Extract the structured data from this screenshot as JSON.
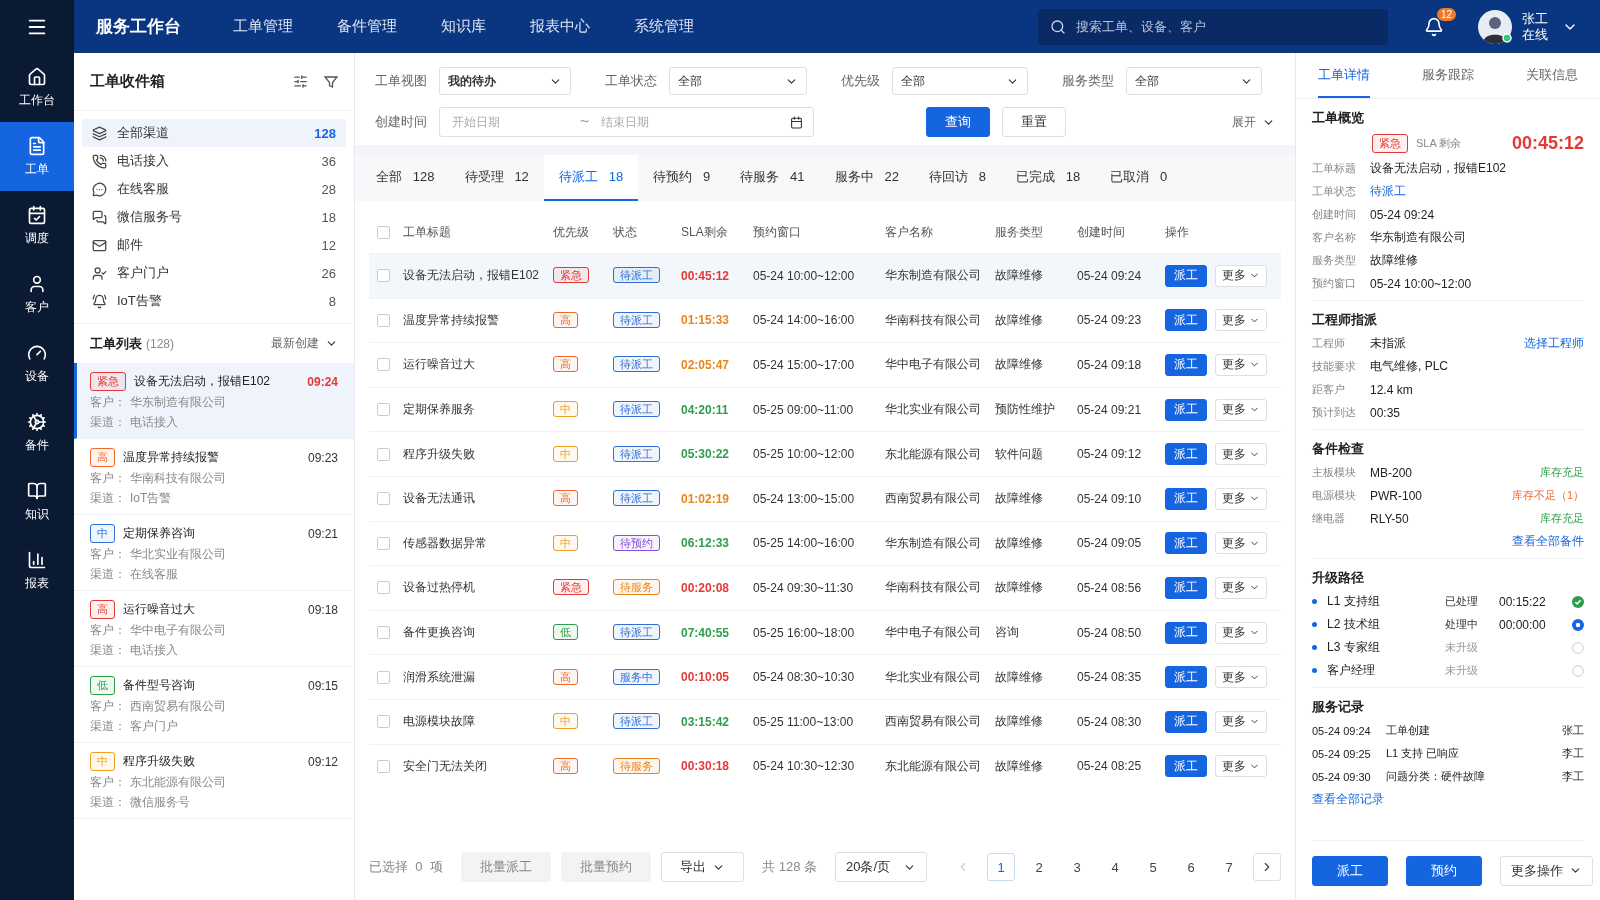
{
  "app": {
    "brand": "服务工作台",
    "nav": [
      {
        "label": "工单管理",
        "selected": false
      },
      {
        "label": "备件管理",
        "selected": false
      },
      {
        "label": "知识库",
        "selected": false
      },
      {
        "label": "报表中心",
        "selected": false
      },
      {
        "label": "系统管理",
        "selected": false
      }
    ],
    "search": {
      "placeholder": "搜索工单、设备、客户"
    },
    "notifications": "12",
    "user": {
      "name": "张工",
      "status": "在线"
    }
  },
  "rail": [
    {
      "label": "工作台",
      "selected": false
    },
    {
      "label": "工单",
      "selected": true
    },
    {
      "label": "调度",
      "selected": false
    },
    {
      "label": "客户",
      "selected": false
    },
    {
      "label": "设备",
      "selected": false
    },
    {
      "label": "备件",
      "selected": false
    },
    {
      "label": "知识",
      "selected": false
    },
    {
      "label": "报表",
      "selected": false
    }
  ],
  "inbox": {
    "title": "工单收件箱",
    "channels": [
      {
        "label": "全部渠道",
        "count": "128",
        "selected": true
      },
      {
        "label": "电话接入",
        "count": "36",
        "selected": false
      },
      {
        "label": "在线客服",
        "count": "28",
        "selected": false
      },
      {
        "label": "微信服务号",
        "count": "18",
        "selected": false
      },
      {
        "label": "邮件",
        "count": "12",
        "selected": false
      },
      {
        "label": "客户门户",
        "count": "26",
        "selected": false
      },
      {
        "label": "IoT告警",
        "count": "8",
        "selected": false
      }
    ],
    "list_title": "工单列表",
    "list_count": "(128)",
    "sort": "最新创建",
    "items": [
      {
        "priority": "紧急",
        "color": "#e53935",
        "title": "设备无法启动，报错E102",
        "time": "09:24",
        "customer_label": "客户：",
        "customer": "华东制造有限公司",
        "channel_label": "渠道：",
        "channel": "电话接入",
        "selected": true
      },
      {
        "priority": "高",
        "color": "#f06a2a",
        "title": "温度异常持续报警",
        "time": "09:23",
        "customer_label": "客户：",
        "customer": "华南科技有限公司",
        "channel_label": "渠道：",
        "channel": "IoT告警",
        "selected": false
      },
      {
        "priority": "中",
        "color": "#2f6fd6",
        "title": "定期保养咨询",
        "time": "09:21",
        "customer_label": "客户：",
        "customer": "华北实业有限公司",
        "channel_label": "渠道：",
        "channel": "在线客服",
        "selected": false
      },
      {
        "priority": "高",
        "color": "#e53935",
        "title": "运行噪音过大",
        "time": "09:18",
        "customer_label": "客户：",
        "customer": "华中电子有限公司",
        "channel_label": "渠道：",
        "channel": "电话接入",
        "selected": false
      },
      {
        "priority": "低",
        "color": "#2e9e4a",
        "title": "备件型号咨询",
        "time": "09:15",
        "customer_label": "客户：",
        "customer": "西南贸易有限公司",
        "channel_label": "渠道：",
        "channel": "客户门户",
        "selected": false
      },
      {
        "priority": "中",
        "color": "#f0a020",
        "title": "程序升级失败",
        "time": "09:12",
        "customer_label": "客户：",
        "customer": "东北能源有限公司",
        "channel_label": "渠道：",
        "channel": "微信服务号",
        "selected": false
      }
    ]
  },
  "filters": {
    "selects": [
      {
        "label": "工单视图",
        "value": "我的待办"
      },
      {
        "label": "工单状态",
        "value": "全部"
      },
      {
        "label": "优先级",
        "value": "全部"
      },
      {
        "label": "服务类型",
        "value": "全部"
      }
    ],
    "date_label": "创建时间",
    "date_from": {
      "placeholder": "开始日期"
    },
    "date_sep": "~",
    "date_to": {
      "placeholder": "结束日期"
    },
    "query": "查询",
    "reset": "重置",
    "expand": "展开"
  },
  "status_tabs": [
    {
      "label": "全部",
      "count": "128",
      "selected": false
    },
    {
      "label": "待受理",
      "count": "12",
      "selected": false
    },
    {
      "label": "待派工",
      "count": "18",
      "selected": true
    },
    {
      "label": "待预约",
      "count": "9",
      "selected": false
    },
    {
      "label": "待服务",
      "count": "41",
      "selected": false
    },
    {
      "label": "服务中",
      "count": "22",
      "selected": false
    },
    {
      "label": "待回访",
      "count": "8",
      "selected": false
    },
    {
      "label": "已完成",
      "count": "18",
      "selected": false
    },
    {
      "label": "已取消",
      "count": "0",
      "selected": false
    }
  ],
  "table": {
    "all_checked": false,
    "columns": [
      "工单标题",
      "优先级",
      "状态",
      "SLA剩余",
      "预约窗口",
      "客户名称",
      "服务类型",
      "创建时间",
      "操作"
    ],
    "rows": [
      {
        "title": "设备无法启动，报错E102",
        "priority": {
          "label": "紧急",
          "color": "#e53935"
        },
        "status": {
          "label": "待派工",
          "color": "#2f6fd6"
        },
        "sla": {
          "text": "00:45:12",
          "kind": "critical"
        },
        "window": "05-24 10:00~12:00",
        "customer": "华东制造有限公司",
        "type": "故障维修",
        "created": "05-24 09:24",
        "dispatch": "派工",
        "more": "更多",
        "selected": true,
        "checked": false
      },
      {
        "title": "温度异常持续报警",
        "priority": {
          "label": "高",
          "color": "#f06a2a"
        },
        "status": {
          "label": "待派工",
          "color": "#2f6fd6"
        },
        "sla": {
          "text": "01:15:33",
          "kind": "warning"
        },
        "window": "05-24 14:00~16:00",
        "customer": "华南科技有限公司",
        "type": "故障维修",
        "created": "05-24 09:23",
        "dispatch": "派工",
        "more": "更多",
        "selected": false,
        "checked": false
      },
      {
        "title": "运行噪音过大",
        "priority": {
          "label": "高",
          "color": "#f06a2a"
        },
        "status": {
          "label": "待派工",
          "color": "#2f6fd6"
        },
        "sla": {
          "text": "02:05:47",
          "kind": "warning"
        },
        "window": "05-24 15:00~17:00",
        "customer": "华中电子有限公司",
        "type": "故障维修",
        "created": "05-24 09:18",
        "dispatch": "派工",
        "more": "更多",
        "selected": false,
        "checked": false
      },
      {
        "title": "定期保养服务",
        "priority": {
          "label": "中",
          "color": "#f0a020"
        },
        "status": {
          "label": "待派工",
          "color": "#2f6fd6"
        },
        "sla": {
          "text": "04:20:11",
          "kind": "normal"
        },
        "window": "05-25 09:00~11:00",
        "customer": "华北实业有限公司",
        "type": "预防性维护",
        "created": "05-24 09:21",
        "dispatch": "派工",
        "more": "更多",
        "selected": false,
        "checked": false
      },
      {
        "title": "程序升级失败",
        "priority": {
          "label": "中",
          "color": "#f0a020"
        },
        "status": {
          "label": "待派工",
          "color": "#2f6fd6"
        },
        "sla": {
          "text": "05:30:22",
          "kind": "normal"
        },
        "window": "05-25 10:00~12:00",
        "customer": "东北能源有限公司",
        "type": "软件问题",
        "created": "05-24 09:12",
        "dispatch": "派工",
        "more": "更多",
        "selected": false,
        "checked": false
      },
      {
        "title": "设备无法通讯",
        "priority": {
          "label": "高",
          "color": "#f06a2a"
        },
        "status": {
          "label": "待派工",
          "color": "#2f6fd6"
        },
        "sla": {
          "text": "01:02:19",
          "kind": "warning"
        },
        "window": "05-24 13:00~15:00",
        "customer": "西南贸易有限公司",
        "type": "故障维修",
        "created": "05-24 09:10",
        "dispatch": "派工",
        "more": "更多",
        "selected": false,
        "checked": false
      },
      {
        "title": "传感器数据异常",
        "priority": {
          "label": "中",
          "color": "#f0a020"
        },
        "status": {
          "label": "待预约",
          "color": "#8a4fd8"
        },
        "sla": {
          "text": "06:12:33",
          "kind": "normal"
        },
        "window": "05-25 14:00~16:00",
        "customer": "华东制造有限公司",
        "type": "故障维修",
        "created": "05-24 09:05",
        "dispatch": "派工",
        "more": "更多",
        "selected": false,
        "checked": false
      },
      {
        "title": "设备过热停机",
        "priority": {
          "label": "紧急",
          "color": "#e53935"
        },
        "status": {
          "label": "待服务",
          "color": "#e8851a"
        },
        "sla": {
          "text": "00:20:08",
          "kind": "critical"
        },
        "window": "05-24 09:30~11:30",
        "customer": "华南科技有限公司",
        "type": "故障维修",
        "created": "05-24 08:56",
        "dispatch": "派工",
        "more": "更多",
        "selected": false,
        "checked": false
      },
      {
        "title": "备件更换咨询",
        "priority": {
          "label": "低",
          "color": "#2e9e4a"
        },
        "status": {
          "label": "待派工",
          "color": "#2f6fd6"
        },
        "sla": {
          "text": "07:40:55",
          "kind": "normal"
        },
        "window": "05-25 16:00~18:00",
        "customer": "华中电子有限公司",
        "type": "咨询",
        "created": "05-24 08:50",
        "dispatch": "派工",
        "more": "更多",
        "selected": false,
        "checked": false
      },
      {
        "title": "润滑系统泄漏",
        "priority": {
          "label": "高",
          "color": "#f06a2a"
        },
        "status": {
          "label": "服务中",
          "color": "#2f6fd6"
        },
        "sla": {
          "text": "00:10:05",
          "kind": "critical"
        },
        "window": "05-24 08:30~10:30",
        "customer": "华北实业有限公司",
        "type": "故障维修",
        "created": "05-24 08:35",
        "dispatch": "派工",
        "more": "更多",
        "selected": false,
        "checked": false
      },
      {
        "title": "电源模块故障",
        "priority": {
          "label": "中",
          "color": "#f0a020"
        },
        "status": {
          "label": "待派工",
          "color": "#2f6fd6"
        },
        "sla": {
          "text": "03:15:42",
          "kind": "normal"
        },
        "window": "05-25 11:00~13:00",
        "customer": "西南贸易有限公司",
        "type": "故障维修",
        "created": "05-24 08:30",
        "dispatch": "派工",
        "more": "更多",
        "selected": false,
        "checked": false
      },
      {
        "title": "安全门无法关闭",
        "priority": {
          "label": "高",
          "color": "#f06a2a"
        },
        "status": {
          "label": "待服务",
          "color": "#e8851a"
        },
        "sla": {
          "text": "00:30:18",
          "kind": "critical"
        },
        "window": "05-24 10:30~12:30",
        "customer": "东北能源有限公司",
        "type": "故障维修",
        "created": "05-24 08:25",
        "dispatch": "派工",
        "more": "更多",
        "selected": false,
        "checked": false
      }
    ]
  },
  "footer": {
    "selected_label": "已选择",
    "selected_count": "0",
    "selected_unit": "项",
    "batch_dispatch": "批量派工",
    "batch_book": "批量预约",
    "export": "导出",
    "total": "共 128 条",
    "page_size": "20条/页",
    "pages": [
      {
        "label": "1",
        "selected": true
      },
      {
        "label": "2",
        "selected": false
      },
      {
        "label": "3",
        "selected": false
      },
      {
        "label": "4",
        "selected": false
      },
      {
        "label": "5",
        "selected": false
      },
      {
        "label": "6",
        "selected": false
      },
      {
        "label": "7",
        "selected": false
      }
    ]
  },
  "detail": {
    "tabs": [
      {
        "label": "工单详情",
        "selected": true
      },
      {
        "label": "服务跟踪",
        "selected": false
      },
      {
        "label": "关联信息",
        "selected": false
      }
    ],
    "overview_title": "工单概览",
    "priority": "紧急",
    "sla_label": "SLA 剩余",
    "sla": "00:45:12",
    "fields": [
      {
        "label": "工单标题",
        "value": "设备无法启动，报错E102",
        "kind": "text"
      },
      {
        "label": "工单状态",
        "value": "待派工",
        "kind": "link"
      },
      {
        "label": "创建时间",
        "value": "05-24 09:24",
        "kind": "text"
      },
      {
        "label": "客户名称",
        "value": "华东制造有限公司",
        "kind": "text"
      },
      {
        "label": "服务类型",
        "value": "故障维修",
        "kind": "text"
      },
      {
        "label": "预约窗口",
        "value": "05-24 10:00~12:00",
        "kind": "text"
      }
    ],
    "engineer_title": "工程师指派",
    "engineer": [
      {
        "label": "工程师",
        "value": "未指派",
        "action": "选择工程师"
      },
      {
        "label": "技能要求",
        "value": "电气维修, PLC"
      },
      {
        "label": "距客户",
        "value": "12.4 km"
      },
      {
        "label": "预计到达",
        "value": "00:35"
      }
    ],
    "parts_title": "备件检查",
    "parts": [
      {
        "label": "主板模块",
        "value": "MB-200",
        "stock": "库存充足",
        "kind": "ok"
      },
      {
        "label": "电源模块",
        "value": "PWR-100",
        "stock": "库存不足（1）",
        "kind": "low"
      },
      {
        "label": "继电器",
        "value": "RLY-50",
        "stock": "库存充足",
        "kind": "ok"
      }
    ],
    "parts_link": "查看全部备件",
    "escalation_title": "升级路径",
    "escalation": [
      {
        "label": "L1 支持组",
        "state": "已处理",
        "time": "00:15:22",
        "kind": "done"
      },
      {
        "label": "L2 技术组",
        "state": "处理中",
        "time": "00:00:00",
        "kind": "active"
      },
      {
        "label": "L3 专家组",
        "state": "未升级",
        "kind": "pending"
      },
      {
        "label": "客户经理",
        "state": "未升级",
        "kind": "pending"
      }
    ],
    "records_title": "服务记录",
    "records": [
      {
        "time": "05-24 09:24",
        "text": "工单创建",
        "by": "张工"
      },
      {
        "time": "05-24 09:25",
        "text": "L1 支持 已响应",
        "by": "李工"
      },
      {
        "time": "05-24 09:30",
        "text": "问题分类：硬件故障",
        "by": "李工"
      }
    ],
    "records_link": "查看全部记录",
    "actions": {
      "dispatch": "派工",
      "book": "预约",
      "more": "更多操作"
    }
  }
}
